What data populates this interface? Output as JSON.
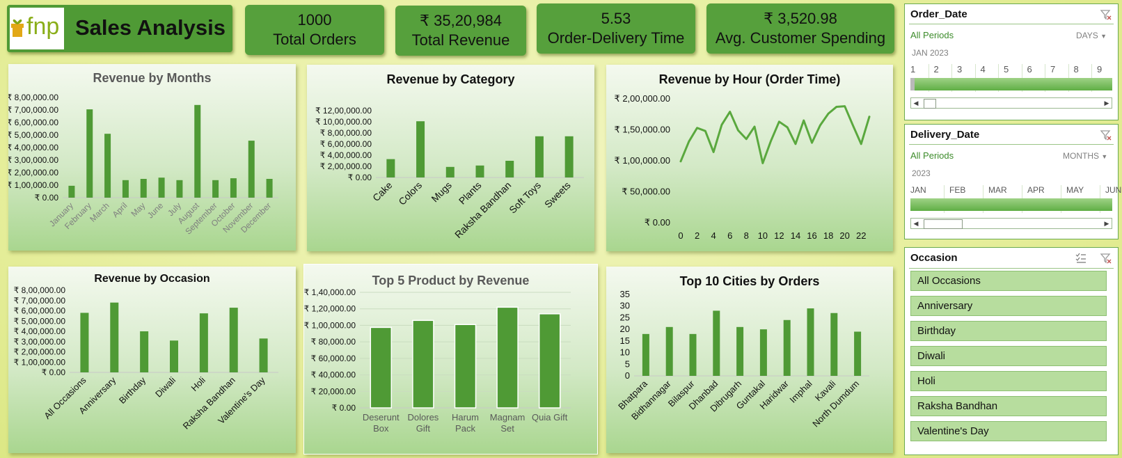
{
  "header": {
    "logo_text": "fnp",
    "title": "Sales Analysis"
  },
  "kpis": [
    {
      "value": "1000",
      "label": "Total Orders"
    },
    {
      "value": "₹ 35,20,984",
      "label": "Total Revenue"
    },
    {
      "value": "5.53",
      "label": "Order-Delivery Time"
    },
    {
      "value": "₹ 3,520.98",
      "label": "Avg. Customer Spending"
    }
  ],
  "colors": {
    "bar": "#4f9a35",
    "kpi_bg": "#56a03c",
    "accent_text": "#3c8b2a"
  },
  "chart_data": [
    {
      "id": "months",
      "type": "bar",
      "title": "Revenue by Months",
      "categories": [
        "January",
        "February",
        "March",
        "April",
        "May",
        "June",
        "July",
        "August",
        "September",
        "October",
        "November",
        "December"
      ],
      "values": [
        95000,
        705000,
        510000,
        140000,
        150000,
        160000,
        140000,
        740000,
        140000,
        155000,
        455000,
        150000
      ],
      "yticks": [
        "₹ 0.00",
        "₹ 1,00,000.00",
        "₹ 2,00,000.00",
        "₹ 3,00,000.00",
        "₹ 4,00,000.00",
        "₹ 5,00,000.00",
        "₹ 6,00,000.00",
        "₹ 7,00,000.00",
        "₹ 8,00,000.00"
      ],
      "ylim": [
        0,
        800000
      ]
    },
    {
      "id": "category",
      "type": "bar",
      "title": "Revenue by Category",
      "categories": [
        "Cake",
        "Colors",
        "Mugs",
        "Plants",
        "Raksha Bandhan",
        "Soft Toys",
        "Sweets"
      ],
      "values": [
        330000,
        1010000,
        190000,
        215000,
        300000,
        740000,
        740000
      ],
      "yticks": [
        "₹ 0.00",
        "₹ 2,00,000.00",
        "₹ 4,00,000.00",
        "₹ 6,00,000.00",
        "₹ 8,00,000.00",
        "₹ 10,00,000.00",
        "₹ 12,00,000.00"
      ],
      "ylim": [
        0,
        1200000
      ]
    },
    {
      "id": "hour",
      "type": "line",
      "title": "Revenue by Hour (Order Time)",
      "x": [
        0,
        1,
        2,
        3,
        4,
        5,
        6,
        7,
        8,
        9,
        10,
        11,
        12,
        13,
        14,
        15,
        16,
        17,
        18,
        19,
        20,
        21,
        22,
        23
      ],
      "values": [
        98000,
        130000,
        152000,
        147000,
        113000,
        157000,
        178000,
        148000,
        134000,
        154000,
        95000,
        131000,
        162000,
        153000,
        126000,
        164000,
        128000,
        156000,
        175000,
        186000,
        187000,
        156000,
        126000,
        170000
      ],
      "xticks": [
        "0",
        "2",
        "4",
        "6",
        "8",
        "10",
        "12",
        "14",
        "16",
        "18",
        "20",
        "22"
      ],
      "yticks": [
        "₹ 0.00",
        "₹ 50,000.00",
        "₹ 1,00,000.00",
        "₹ 1,50,000.00",
        "₹ 2,00,000.00"
      ],
      "ylim": [
        0,
        200000
      ]
    },
    {
      "id": "occasion",
      "type": "bar",
      "title": "Revenue by Occasion",
      "categories": [
        "All Occasions",
        "Anniversary",
        "Birthday",
        "Diwali",
        "Holi",
        "Raksha Bandhan",
        "Valentine's Day"
      ],
      "values": [
        580000,
        680000,
        400000,
        310000,
        575000,
        630000,
        330000
      ],
      "yticks": [
        "₹ 0.00",
        "₹ 1,00,000.00",
        "₹ 2,00,000.00",
        "₹ 3,00,000.00",
        "₹ 4,00,000.00",
        "₹ 5,00,000.00",
        "₹ 6,00,000.00",
        "₹ 7,00,000.00",
        "₹ 8,00,000.00"
      ],
      "ylim": [
        0,
        800000
      ]
    },
    {
      "id": "products",
      "type": "bar",
      "title": "Top 5 Product by Revenue",
      "categories": [
        "Deserunt Box",
        "Dolores Gift",
        "Harum Pack",
        "Magnam Set",
        "Quia Gift"
      ],
      "category_lines": [
        [
          "Deserunt",
          "Box"
        ],
        [
          "Dolores",
          "Gift"
        ],
        [
          "Harum",
          "Pack"
        ],
        [
          "Magnam",
          "Set"
        ],
        [
          "Quia Gift"
        ]
      ],
      "values": [
        97500,
        106000,
        101000,
        122000,
        114000
      ],
      "yticks": [
        "₹ 0.00",
        "₹ 20,000.00",
        "₹ 40,000.00",
        "₹ 60,000.00",
        "₹ 80,000.00",
        "₹ 1,00,000.00",
        "₹ 1,20,000.00",
        "₹ 1,40,000.00"
      ],
      "ylim": [
        0,
        140000
      ]
    },
    {
      "id": "cities",
      "type": "bar",
      "title": "Top 10 Cities by Orders",
      "categories": [
        "Bhatpara",
        "Bidhannagar",
        "Bilaspur",
        "Dhanbad",
        "Dibrugarh",
        "Guntakal",
        "Haridwar",
        "Imphal",
        "Kavali",
        "North Dumdum"
      ],
      "values": [
        18,
        21,
        18,
        28,
        21,
        20,
        24,
        29,
        27,
        19
      ],
      "yticks": [
        "0",
        "5",
        "10",
        "15",
        "20",
        "25",
        "30",
        "35"
      ],
      "ylim": [
        0,
        35
      ]
    }
  ],
  "slicers": {
    "order_date": {
      "title": "Order_Date",
      "selection": "All Periods",
      "level": "DAYS",
      "period": "JAN 2023",
      "ticks": [
        "1",
        "2",
        "3",
        "4",
        "5",
        "6",
        "7",
        "8",
        "9"
      ]
    },
    "delivery_date": {
      "title": "Delivery_Date",
      "selection": "All Periods",
      "level": "MONTHS",
      "period": "2023",
      "ticks": [
        "JAN",
        "FEB",
        "MAR",
        "APR",
        "MAY",
        "JUN"
      ]
    },
    "occasion": {
      "title": "Occasion",
      "items": [
        "All Occasions",
        "Anniversary",
        "Birthday",
        "Diwali",
        "Holi",
        "Raksha Bandhan",
        "Valentine's Day"
      ]
    }
  }
}
